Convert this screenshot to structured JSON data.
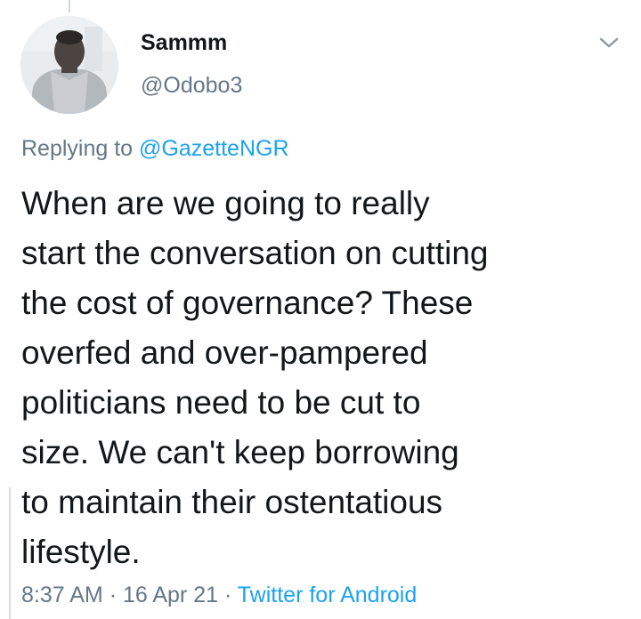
{
  "tweet": {
    "author_name": "Sammm",
    "author_handle": "@Odobo3",
    "replying_prefix": "Replying to",
    "replying_to": "@GazetteNGR",
    "text_lines": [
      "When are we going to really",
      "start the conversation on cutting",
      "the cost of governance? These",
      "overfed and over-pampered",
      "politicians need to be cut to",
      "size. We can't keep borrowing",
      "to maintain their ostentatious",
      "lifestyle."
    ],
    "time": "8:37 AM",
    "separator": "·",
    "date": "16 Apr 21",
    "source": "Twitter for Android"
  },
  "icons": {
    "more": "chevron-down-icon",
    "avatar": "avatar-photo"
  },
  "colors": {
    "text_primary": "#14171a",
    "text_secondary": "#657786",
    "accent": "#1da1f2",
    "background": "#ffffff"
  }
}
